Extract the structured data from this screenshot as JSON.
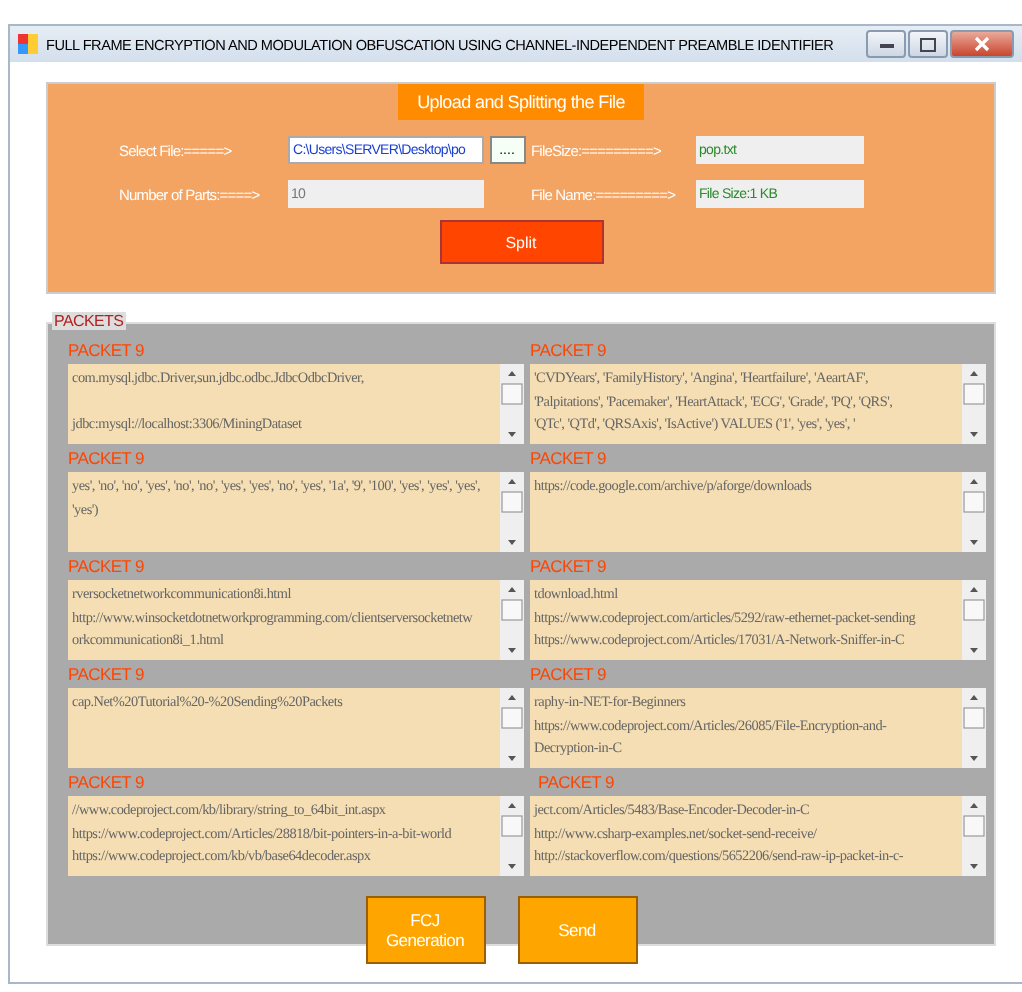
{
  "window": {
    "title": "FULL FRAME ENCRYPTION AND MODULATION OBFUSCATION USING CHANNEL-INDEPENDENT PREAMBLE IDENTIFIER"
  },
  "upload": {
    "heading": "Upload and Splitting the File",
    "fields": [
      {
        "label": "Select File:=====>",
        "value": "C:\\Users\\SERVER\\Desktop\\po",
        "kind": "path"
      },
      {
        "label": "FileSize:=========>",
        "value": "pop.txt",
        "kind": "info"
      },
      {
        "label": "Number of Parts:====>",
        "value": "10",
        "kind": "readonly"
      },
      {
        "label": "File Name:=========>",
        "value": "File Size:1 KB",
        "kind": "info"
      }
    ],
    "browse_button": "....",
    "split_button": "Split"
  },
  "packets": {
    "title": "PACKETS",
    "items": [
      {
        "label": "PACKET 9",
        "lines": [
          "com.mysql.jdbc.Driver,sun.jdbc.odbc.JdbcOdbcDriver,"
        ],
        "lines_after_blank": [
          "jdbc:mysql://localhost:3306/MiningDataset"
        ]
      },
      {
        "label": "PACKET 9",
        "lines": [
          "'CVDYears', 'FamilyHistory', 'Angina', 'Heartfailure', 'AeartAF',",
          "'Palpitations', 'Pacemaker', 'HeartAttack', 'ECG', 'Grade', 'PQ', 'QRS',",
          "'QTc', 'QTd', 'QRSAxis', 'IsActive') VALUES ('1', 'yes', 'yes', '"
        ]
      },
      {
        "label": "PACKET 9",
        "lines": [
          "yes', 'no', 'no', 'yes', 'no', 'no', 'yes', 'yes', 'no', 'yes', '1a', '9', '100', 'yes', 'yes', 'yes',",
          "'yes')"
        ]
      },
      {
        "label": "PACKET 9",
        "lines": [
          "https://code.google.com/archive/p/aforge/downloads"
        ]
      },
      {
        "label": "PACKET 9",
        "lines": [
          "rversocketnetworkcommunication8i.html",
          "http://www.winsocketdotnetworkprogramming.com/clientserversocketnetw",
          "orkcommunication8i_1.html"
        ]
      },
      {
        "label": "PACKET 9",
        "lines": [
          "tdownload.html",
          "https://www.codeproject.com/articles/5292/raw-ethernet-packet-sending",
          "https://www.codeproject.com/Articles/17031/A-Network-Sniffer-in-C"
        ]
      },
      {
        "label": "PACKET 9",
        "lines": [
          "cap.Net%20Tutorial%20-%20Sending%20Packets"
        ]
      },
      {
        "label": "PACKET 9",
        "lines": [
          "raphy-in-NET-for-Beginners",
          "https://www.codeproject.com/Articles/26085/File-Encryption-and-",
          "Decryption-in-C"
        ]
      },
      {
        "label": "PACKET 9",
        "lines": [
          "//www.codeproject.com/kb/library/string_to_64bit_int.aspx",
          "https://www.codeproject.com/Articles/28818/bit-pointers-in-a-bit-world",
          "https://www.codeproject.com/kb/vb/base64decoder.aspx"
        ]
      },
      {
        "label": "PACKET 9",
        "lines": [
          "ject.com/Articles/5483/Base-Encoder-Decoder-in-C",
          "http://www.csharp-examples.net/socket-send-receive/",
          "http://stackoverflow.com/questions/5652206/send-raw-ip-packet-in-c-"
        ]
      }
    ]
  },
  "buttons": [
    "FCJ Generation",
    "Send"
  ]
}
